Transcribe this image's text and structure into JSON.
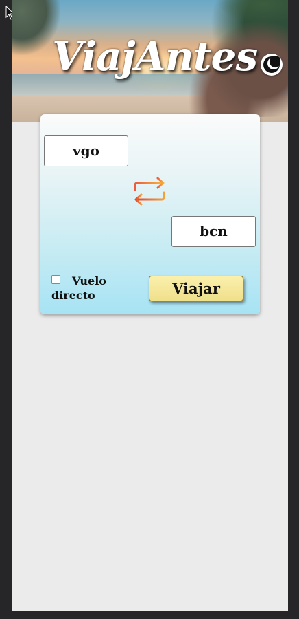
{
  "header": {
    "brand": "ViajAntes",
    "theme_toggle_icon": "moon-icon"
  },
  "search": {
    "origin_value": "vgo",
    "destination_value": "bcn",
    "swap_icon": "swap-arrows-icon",
    "direct_label": "Vuelo directo",
    "direct_checked": false,
    "submit_label": "Viajar"
  },
  "colors": {
    "swap_top_arrow": "#f3a43a",
    "swap_bottom_arrow": "#ea4b3b",
    "button_bg": "#f5e89a",
    "card_bottom": "#a7e3f4",
    "page_bg": "#ebebeb"
  }
}
